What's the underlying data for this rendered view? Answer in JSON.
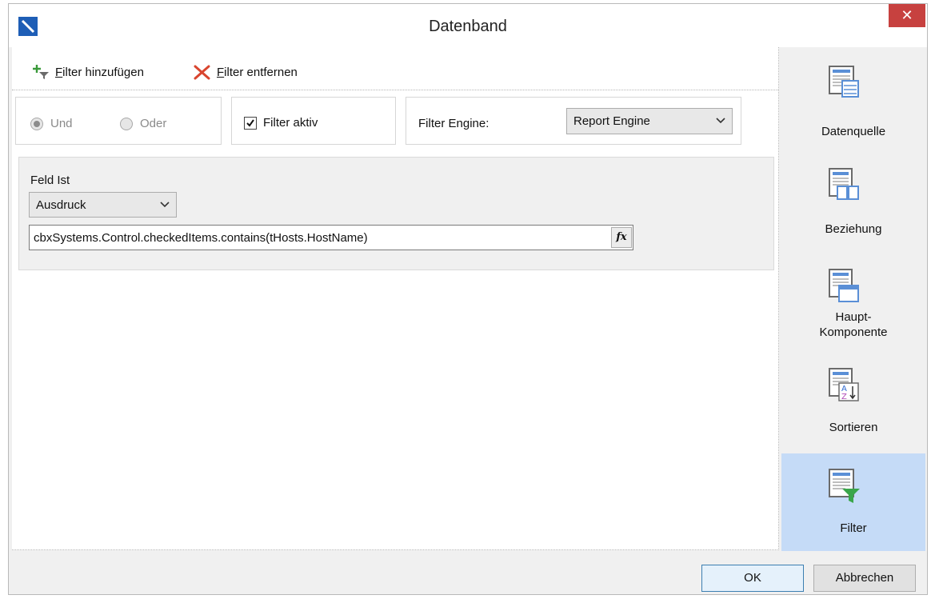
{
  "window": {
    "title": "Datenband",
    "close_glyph": "✕"
  },
  "toolbar": {
    "add_filter": {
      "prefix": "",
      "mnemonic": "F",
      "rest": "ilter hinzufügen",
      "icon": "add-filter-icon"
    },
    "remove_filter": {
      "mnemonic": "F",
      "rest": "ilter entfernen",
      "icon": "remove-filter-icon"
    }
  },
  "logic": {
    "and_label": "Und",
    "or_label": "Oder",
    "selected": "Und"
  },
  "filter_active": {
    "label": "Filter aktiv",
    "checked": true
  },
  "engine": {
    "label": "Filter Engine:",
    "value": "Report Engine"
  },
  "filter": {
    "field_label": "Feld Ist",
    "type_value": "Ausdruck",
    "expression": "cbxSystems.Control.checkedItems.contains(tHosts.HostName)",
    "fx_label": "fx"
  },
  "sidebar": {
    "items": [
      {
        "label": "Datenquelle",
        "icon": "datasource-icon"
      },
      {
        "label": "Beziehung",
        "icon": "relation-icon"
      },
      {
        "label_line1": "Haupt-",
        "label_line2": "Komponente",
        "icon": "master-component-icon"
      },
      {
        "label": "Sortieren",
        "icon": "sort-icon"
      },
      {
        "label": "Filter",
        "icon": "filter-icon",
        "active": true
      }
    ]
  },
  "footer": {
    "ok": "OK",
    "cancel": "Abbrechen"
  },
  "colors": {
    "active_bg": "#c5dbf7",
    "close_bg": "#c7413f",
    "accent": "#1e5eb6"
  }
}
